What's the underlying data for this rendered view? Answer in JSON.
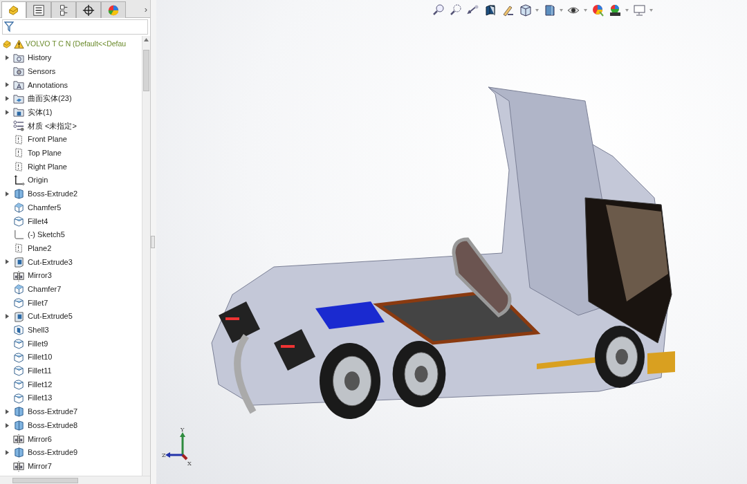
{
  "panel_tabs": [
    {
      "kind": "features",
      "selected": true
    },
    {
      "kind": "properties",
      "selected": false
    },
    {
      "kind": "configurations",
      "selected": false
    },
    {
      "kind": "dimxpert",
      "selected": false
    },
    {
      "kind": "appearance",
      "selected": false
    }
  ],
  "more_tabs": "›",
  "tree": {
    "root": {
      "label": "VOLVO T C N",
      "config": "(Default<<Defau",
      "warning": true
    },
    "items": [
      {
        "label": "History",
        "kind": "history",
        "expandable": true
      },
      {
        "label": "Sensors",
        "kind": "sensors",
        "expandable": false
      },
      {
        "label": "Annotations",
        "kind": "annotations",
        "expandable": true
      },
      {
        "label": "曲面实体(23)",
        "kind": "surface-folder",
        "expandable": true
      },
      {
        "label": "实体(1)",
        "kind": "solid-folder",
        "expandable": true
      },
      {
        "label": "材质 <未指定>",
        "kind": "material",
        "expandable": false
      },
      {
        "label": "Front Plane",
        "kind": "plane",
        "expandable": false
      },
      {
        "label": "Top Plane",
        "kind": "plane",
        "expandable": false
      },
      {
        "label": "Right Plane",
        "kind": "plane",
        "expandable": false
      },
      {
        "label": "Origin",
        "kind": "origin",
        "expandable": false
      },
      {
        "label": "Boss-Extrude2",
        "kind": "extrude",
        "expandable": true
      },
      {
        "label": "Chamfer5",
        "kind": "chamfer",
        "expandable": false
      },
      {
        "label": "Fillet4",
        "kind": "fillet",
        "expandable": false
      },
      {
        "label": "(-) Sketch5",
        "kind": "sketch",
        "expandable": false
      },
      {
        "label": "Plane2",
        "kind": "plane",
        "expandable": false
      },
      {
        "label": "Cut-Extrude3",
        "kind": "cut",
        "expandable": true
      },
      {
        "label": "Mirror3",
        "kind": "mirror",
        "expandable": false
      },
      {
        "label": "Chamfer7",
        "kind": "chamfer",
        "expandable": false
      },
      {
        "label": "Fillet7",
        "kind": "fillet",
        "expandable": false
      },
      {
        "label": "Cut-Extrude5",
        "kind": "cut",
        "expandable": true
      },
      {
        "label": "Shell3",
        "kind": "shell",
        "expandable": false
      },
      {
        "label": "Fillet9",
        "kind": "fillet",
        "expandable": false
      },
      {
        "label": "Fillet10",
        "kind": "fillet",
        "expandable": false
      },
      {
        "label": "Fillet11",
        "kind": "fillet",
        "expandable": false
      },
      {
        "label": "Fillet12",
        "kind": "fillet",
        "expandable": false
      },
      {
        "label": "Fillet13",
        "kind": "fillet",
        "expandable": false
      },
      {
        "label": "Boss-Extrude7",
        "kind": "extrude",
        "expandable": true
      },
      {
        "label": "Boss-Extrude8",
        "kind": "extrude",
        "expandable": true
      },
      {
        "label": "Mirror6",
        "kind": "mirror",
        "expandable": false
      },
      {
        "label": "Boss-Extrude9",
        "kind": "extrude",
        "expandable": true
      },
      {
        "label": "Mirror7",
        "kind": "mirror",
        "expandable": false
      }
    ]
  },
  "view_toolbar": [
    {
      "kind": "zoom-fit",
      "dropdown": false
    },
    {
      "kind": "zoom-area",
      "dropdown": false
    },
    {
      "kind": "previous-view",
      "dropdown": false
    },
    {
      "kind": "section-view",
      "dropdown": false
    },
    {
      "kind": "dynamic-annotation",
      "dropdown": false
    },
    {
      "kind": "view-orientation",
      "dropdown": true
    },
    {
      "kind": "display-style",
      "dropdown": true
    },
    {
      "kind": "hide-show",
      "dropdown": true
    },
    {
      "kind": "edit-appearance",
      "dropdown": false
    },
    {
      "kind": "scene",
      "dropdown": true
    },
    {
      "kind": "view-settings",
      "dropdown": true
    }
  ],
  "triad": {
    "x": "X",
    "y": "Y",
    "z": "Z"
  }
}
